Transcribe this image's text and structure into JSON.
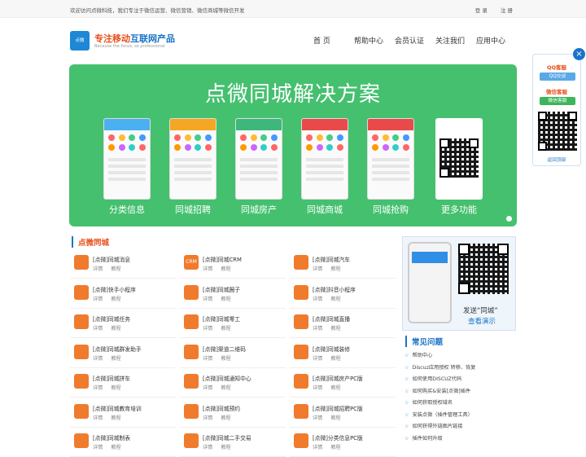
{
  "topbar": {
    "welcome": "欢迎访问点微科技，我们专注于微信运营、微信营销、微信商城等微信开发",
    "login": "登 录",
    "register": "注 册"
  },
  "logo": {
    "mark": "点微",
    "tag_a": "专注移动",
    "tag_b": "互联网产品",
    "sub": "Because the focus, so professional"
  },
  "nav": [
    "首 页",
    "帮助中心",
    "会员认证",
    "关注我们",
    "应用中心"
  ],
  "banner": {
    "title": "点微同城解决方案",
    "captions": [
      "分类信息",
      "同城招聘",
      "同城房产",
      "同城商城",
      "同城抢购",
      "更多功能"
    ]
  },
  "section": {
    "title": "点微同城"
  },
  "actions": {
    "detail": "详情",
    "tutorial": "教程"
  },
  "items": [
    {
      "name": "[点微]同城消息",
      "color": "#f07b2c"
    },
    {
      "name": "[点微]同城CRM",
      "color": "#f07b2c",
      "icon_text": "CRM"
    },
    {
      "name": "[点微]同城汽车",
      "color": "#f07b2c"
    },
    {
      "name": "[点微]快手小程序",
      "color": "#f07b2c"
    },
    {
      "name": "[点微]同城圈子",
      "color": "#f07b2c"
    },
    {
      "name": "[点微]抖音小程序",
      "color": "#f07b2c"
    },
    {
      "name": "[点微]同城任务",
      "color": "#f07b2c"
    },
    {
      "name": "[点微]同城零工",
      "color": "#f07b2c"
    },
    {
      "name": "[点微]同城直播",
      "color": "#f07b2c"
    },
    {
      "name": "[点微]同城群发助手",
      "color": "#f07b2c"
    },
    {
      "name": "[点微]渠道二维码",
      "color": "#f07b2c"
    },
    {
      "name": "[点微]同城装修",
      "color": "#f07b2c"
    },
    {
      "name": "[点微]同城拼车",
      "color": "#f07b2c"
    },
    {
      "name": "[点微]同城通知中心",
      "color": "#f07b2c"
    },
    {
      "name": "[点微]同城房产PC版",
      "color": "#f07b2c"
    },
    {
      "name": "[点微]同城教育培训",
      "color": "#f07b2c"
    },
    {
      "name": "[点微]同城预约",
      "color": "#f07b2c"
    },
    {
      "name": "[点微]同城招聘PC版",
      "color": "#f07b2c"
    },
    {
      "name": "[点微]同城制表",
      "color": "#f07b2c"
    },
    {
      "name": "[点微]同城二手交易",
      "color": "#f07b2c"
    },
    {
      "name": "[点微]分类信息PC版",
      "color": "#f07b2c"
    }
  ],
  "sidead": {
    "line1": "发送“同城”",
    "line2": "查看演示"
  },
  "faq": {
    "title": "常见问题",
    "items": [
      "帮助中心",
      "Discuz应用授权 转移、恢复",
      "如何使用DISCUZ代码",
      "如何购买&安装[点微]插件",
      "如何获取授权域名",
      "安装点微（插件管理工具）",
      "如何获得外链图片链接",
      "插件如何升级"
    ]
  },
  "float": {
    "qq_title": "QQ客服",
    "qq_btn": "QQ交谈",
    "wx_title": "微信客服",
    "wx_btn": "微信客服",
    "back_top": "返回顶部"
  },
  "colors": {
    "green": "#45c06f",
    "orange": "#e94e1b",
    "blue": "#1a73c7"
  }
}
